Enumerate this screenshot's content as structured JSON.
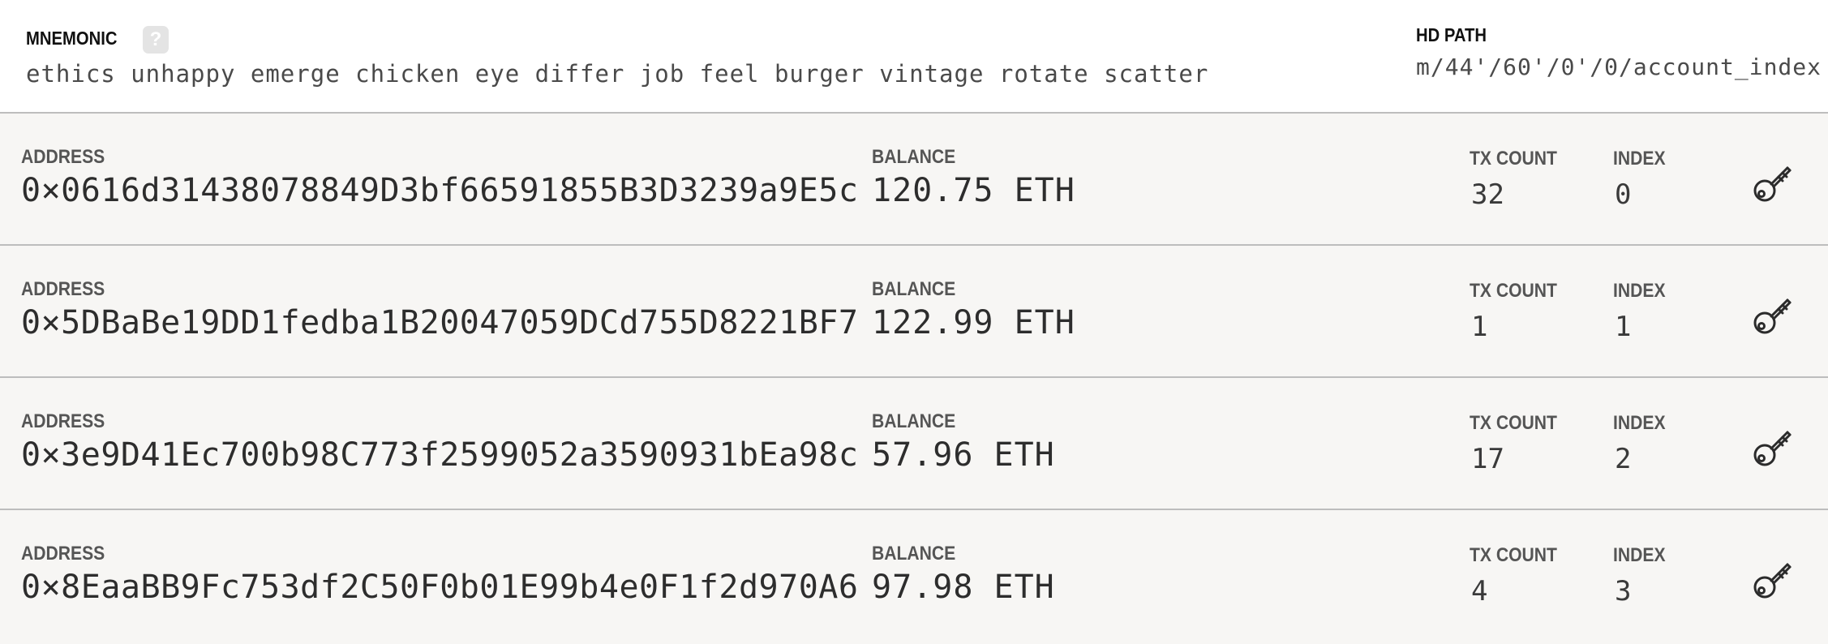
{
  "header": {
    "mnemonic_label": "MNEMONIC",
    "help_label": "?",
    "mnemonic": "ethics unhappy emerge chicken eye differ job feel burger vintage rotate scatter",
    "hd_path_label": "HD PATH",
    "hd_path": "m/44'/60'/0'/0/account_index"
  },
  "labels": {
    "address": "ADDRESS",
    "balance": "BALANCE",
    "tx_count": "TX COUNT",
    "index": "INDEX"
  },
  "accounts": [
    {
      "address": "0×0616d31438078849D3bf66591855B3D3239a9E5c",
      "balance": "120.75 ETH",
      "tx_count": "32",
      "index": "0"
    },
    {
      "address": "0×5DBaBe19DD1fedba1B20047059DCd755D8221BF7",
      "balance": "122.99 ETH",
      "tx_count": "1",
      "index": "1"
    },
    {
      "address": "0×3e9D41Ec700b98C773f2599052a3590931bEa98c",
      "balance": "57.96 ETH",
      "tx_count": "17",
      "index": "2"
    },
    {
      "address": "0×8EaaBB9Fc753df2C50F0b01E99b4e0F1f2d970A6",
      "balance": "97.98 ETH",
      "tx_count": "4",
      "index": "3"
    }
  ],
  "icons": {
    "row_action": "key-icon",
    "help": "question-icon"
  }
}
